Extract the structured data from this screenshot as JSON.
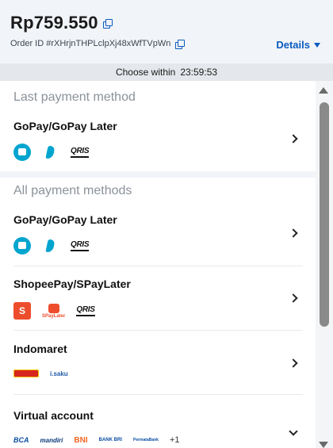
{
  "header": {
    "amount": "Rp759.550",
    "order_id": "Order ID #rXHrjnTHPLclpXj48xWfTVpWn",
    "details_label": "Details"
  },
  "timer": {
    "label": "Choose within",
    "value": "23:59:53"
  },
  "last_section": {
    "title": "Last payment method",
    "items": [
      {
        "title": "GoPay/GoPay Later",
        "logos": [
          "gopay-icon",
          "gopaylater-icon",
          "QRIS"
        ]
      }
    ]
  },
  "all_section": {
    "title": "All payment methods",
    "items": [
      {
        "title": "GoPay/GoPay Later",
        "logos": [
          "gopay-icon",
          "gopaylater-icon",
          "QRIS"
        ]
      },
      {
        "title": "ShopeePay/SPayLater",
        "logos": [
          "S",
          "SPayLater",
          "QRIS"
        ]
      },
      {
        "title": "Indomaret",
        "logos": [
          "indomaret-icon",
          "i.saku"
        ]
      },
      {
        "title": "Virtual account",
        "logos": [
          "BCA",
          "mandiri",
          "BNI",
          "BANK BRI",
          "PermataBank",
          "+1"
        ]
      }
    ]
  },
  "colors": {
    "accent": "#0a5bbf",
    "header_bg": "#f1f4f8",
    "timer_bg": "#e4e7eb",
    "gopay": "#00a5cf",
    "shopee": "#ee4d2d"
  }
}
